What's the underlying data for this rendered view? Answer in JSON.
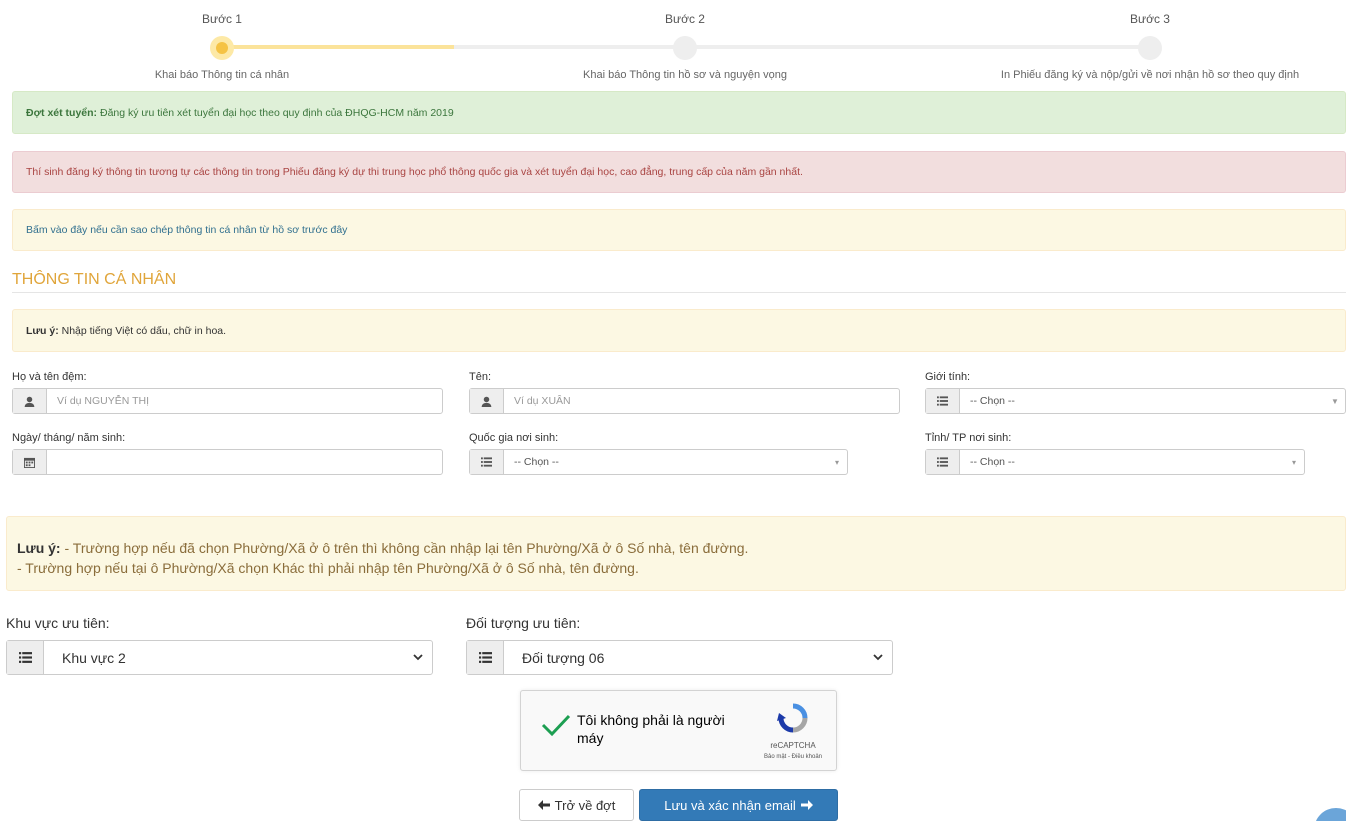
{
  "steps": [
    {
      "title": "Bước 1",
      "desc": "Khai báo Thông tin cá nhân"
    },
    {
      "title": "Bước 2",
      "desc": "Khai báo Thông tin hồ sơ và nguyện vọng"
    },
    {
      "title": "Bước 3",
      "desc": "In Phiếu đăng ký và nộp/gửi về nơi nhận hồ sơ theo quy định"
    }
  ],
  "alerts": {
    "round_label": "Đợt xét tuyển:",
    "round_text": " Đăng ký ưu tiên xét tuyển đại học theo quy định của ĐHQG-HCM năm 2019",
    "danger_text": "Thí sinh đăng ký thông tin tương tự các thông tin trong Phiếu đăng ký dự thi trung học phổ thông quốc gia và xét tuyển đại học, cao đẳng, trung cấp của năm gần nhất.",
    "copy_link": "Bấm vào đây nếu cần sao chép thông tin cá nhân từ hồ sơ trước đây"
  },
  "section": {
    "title": "THÔNG TIN CÁ NHÂN"
  },
  "note1": {
    "label": "Lưu ý:",
    "text": " Nhập tiếng Việt có dấu, chữ in hoa."
  },
  "form": {
    "ho_label": "Họ và tên đệm:",
    "ho_placeholder": "Ví dụ NGUYỄN THỊ",
    "ten_label": "Tên:",
    "ten_placeholder": "Ví dụ XUÂN",
    "gioitinh_label": "Giới tính:",
    "gioitinh_value": "-- Chọn --",
    "ngaysinh_label": "Ngày/ tháng/ năm sinh:",
    "ngaysinh_value": "",
    "quocgia_label": "Quốc gia nơi sinh:",
    "quocgia_value": "-- Chọn --",
    "tinh_label": "Tỉnh/ TP nơi sinh:",
    "tinh_value": "-- Chọn --"
  },
  "note2": {
    "label": "Lưu ý:",
    "line1": " - Trường hợp nếu đã chọn Phường/Xã ở ô trên thì không cần nhập lại tên Phường/Xã ở ô Số nhà, tên đường.",
    "line2": "- Trường hợp nếu tại ô Phường/Xã chọn Khác thì phải nhập tên Phường/Xã ở ô Số nhà, tên đường."
  },
  "priority": {
    "area_label": "Khu vực ưu tiên:",
    "area_value": "Khu vực 2",
    "subject_label": "Đối tượng ưu tiên:",
    "subject_value": "Đối tượng 06"
  },
  "captcha": {
    "text": "Tôi không phải là người máy",
    "brand": "reCAPTCHA",
    "terms": "Bảo mật - Điều khoản"
  },
  "buttons": {
    "back": "Trở về đợt",
    "save": "Lưu và xác nhận email"
  },
  "icons": {
    "user": "user-icon",
    "calendar": "calendar-icon",
    "list": "list-icon",
    "arrow_left": "arrow-left-icon",
    "arrow_right": "arrow-right-icon"
  },
  "colors": {
    "accent": "#e0a53a",
    "primary": "#337ab7",
    "step_active": "#f5c344"
  }
}
